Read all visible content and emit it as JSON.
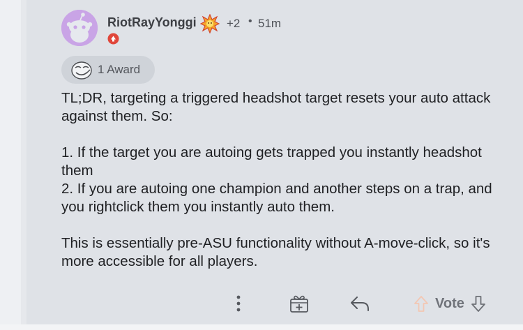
{
  "post": {
    "author": "RiotRayYonggi",
    "extra_flair_count": "+2",
    "separator": "•",
    "time_ago": "51m",
    "award": {
      "label": "1 Award"
    },
    "body": [
      "TL;DR, targeting a triggered headshot target resets your auto attack against them. So:",
      "1. If the target you are autoing gets trapped you instantly headshot them\n2. If you are autoing one champion and another steps on a trap, and you rightclick them you instantly auto them.",
      "This is essentially pre-ASU functionality without A-move-click, so it's more accessible for all players."
    ]
  },
  "actions": {
    "vote_label": "Vote",
    "icons": [
      "more-options-icon",
      "gift-award-icon",
      "reply-icon",
      "upvote-icon",
      "downvote-icon"
    ]
  },
  "colors": {
    "background": "#dfe2e7",
    "avatar": "#c9a4e6",
    "mod_badge": "#e0463a",
    "muted_text": "#70737a"
  }
}
